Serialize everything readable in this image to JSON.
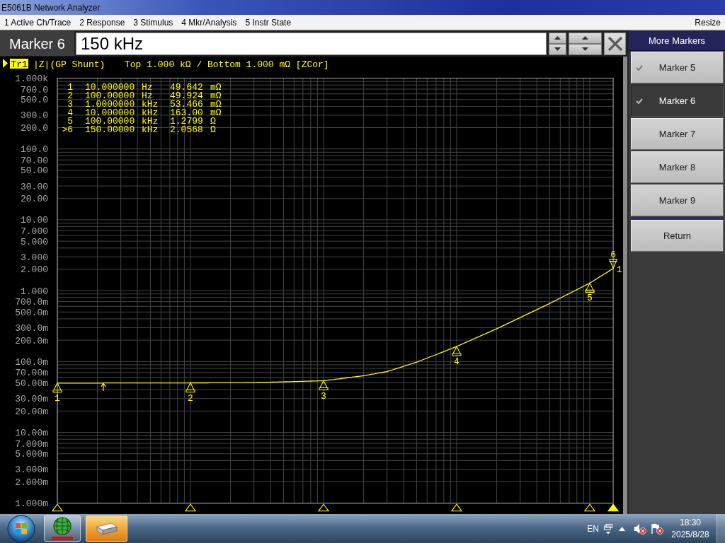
{
  "window": {
    "title": "E5061B Network Analyzer"
  },
  "menu": {
    "items": [
      "1 Active Ch/Trace",
      "2 Response",
      "3 Stimulus",
      "4 Mkr/Analysis",
      "5 Instr State"
    ],
    "right_item": "Resize"
  },
  "entry": {
    "label": "Marker 6",
    "value": "150 kHz"
  },
  "trace": {
    "active": true,
    "name": "Tr1",
    "format": "|Z|(GP Shunt)",
    "scale": "Top 1.000 kΩ / Bottom 1.000 mΩ [ZCor]",
    "end_label": "1"
  },
  "y_axis_labels": [
    "1.000k",
    "700.0",
    "500.0",
    "300.0",
    "200.0",
    "100.0",
    "70.00",
    "50.00",
    "30.00",
    "20.00",
    "10.00",
    "7.000",
    "5.000",
    "3.000",
    "2.000",
    "1.000",
    "700.0m",
    "500.0m",
    "300.0m",
    "200.0m",
    "100.0m",
    "70.00m",
    "50.00m",
    "30.00m",
    "20.00m",
    "10.00m",
    "7.000m",
    "5.000m",
    "3.000m",
    "2.000m",
    "1.000m"
  ],
  "marker_table": [
    {
      "number": "1",
      "stimulus": "10.000000",
      "stimulus_unit": "Hz",
      "response": "49.642",
      "response_unit": "mΩ"
    },
    {
      "number": "2",
      "stimulus": "100.00000",
      "stimulus_unit": "Hz",
      "response": "49.924",
      "response_unit": "mΩ"
    },
    {
      "number": "3",
      "stimulus": "1.0000000",
      "stimulus_unit": "kHz",
      "response": "53.466",
      "response_unit": "mΩ"
    },
    {
      "number": "4",
      "stimulus": "10.000000",
      "stimulus_unit": "kHz",
      "response": "163.00",
      "response_unit": "mΩ"
    },
    {
      "number": "5",
      "stimulus": "100.00000",
      "stimulus_unit": "kHz",
      "response": "1.2799",
      "response_unit": "Ω"
    },
    {
      "number": ">6",
      "stimulus": "150.00000",
      "stimulus_unit": "kHz",
      "response": "2.0568",
      "response_unit": "Ω"
    }
  ],
  "plot_markers": [
    {
      "label": "1",
      "active": false
    },
    {
      "label": "2",
      "active": false
    },
    {
      "label": "3",
      "active": false
    },
    {
      "label": "4",
      "active": false
    },
    {
      "label": "5",
      "active": false
    },
    {
      "label": "6",
      "active": true
    }
  ],
  "softkeys": {
    "title": "More Markers",
    "items": [
      {
        "label": "Marker 5",
        "checked": true,
        "selected": false
      },
      {
        "label": "Marker 6",
        "checked": true,
        "selected": true
      },
      {
        "label": "Marker 7",
        "checked": false,
        "selected": false
      },
      {
        "label": "Marker 8",
        "checked": false,
        "selected": false
      },
      {
        "label": "Marker 9",
        "checked": false,
        "selected": false
      }
    ],
    "return": "Return"
  },
  "taskbar": {
    "apps": [
      {
        "kind": "analyzer",
        "selected": false
      },
      {
        "kind": "drive",
        "selected": true
      }
    ],
    "language": "EN",
    "time": "18:30",
    "date": "2025/8/28"
  }
}
